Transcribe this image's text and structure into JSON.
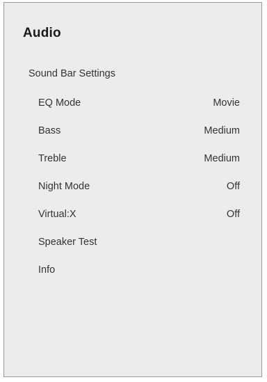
{
  "title": "Audio",
  "section": "Sound Bar Settings",
  "items": [
    {
      "label": "EQ Mode",
      "value": "Movie"
    },
    {
      "label": "Bass",
      "value": "Medium"
    },
    {
      "label": "Treble",
      "value": "Medium"
    },
    {
      "label": "Night Mode",
      "value": "Off"
    },
    {
      "label": "Virtual:X",
      "value": "Off"
    },
    {
      "label": "Speaker Test",
      "value": ""
    },
    {
      "label": "Info",
      "value": ""
    }
  ]
}
